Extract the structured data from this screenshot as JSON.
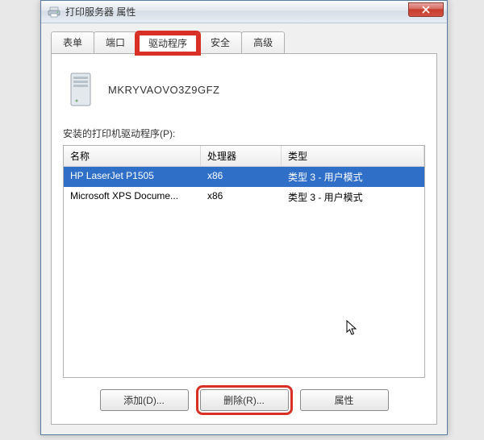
{
  "window": {
    "title": "打印服务器 属性"
  },
  "tabs": [
    {
      "label": "表单"
    },
    {
      "label": "端口"
    },
    {
      "label": "驱动程序"
    },
    {
      "label": "安全"
    },
    {
      "label": "高级"
    }
  ],
  "server": {
    "name": "MKRYVAOVO3Z9GFZ"
  },
  "drivers": {
    "section_label": "安装的打印机驱动程序(P):",
    "columns": {
      "name": "名称",
      "processor": "处理器",
      "type": "类型"
    },
    "rows": [
      {
        "name": "HP LaserJet P1505",
        "processor": "x86",
        "type": "类型 3 - 用户模式",
        "selected": true
      },
      {
        "name": "Microsoft XPS Docume...",
        "processor": "x86",
        "type": "类型 3 - 用户模式",
        "selected": false
      }
    ]
  },
  "buttons": {
    "add": "添加(D)...",
    "remove": "删除(R)...",
    "properties": "属性"
  }
}
